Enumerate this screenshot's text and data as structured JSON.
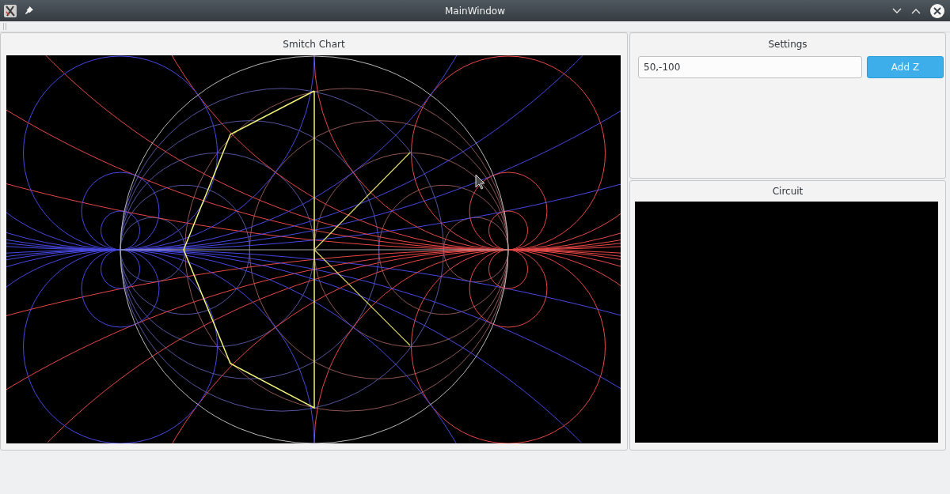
{
  "window": {
    "title": "MainWindow"
  },
  "smith_chart": {
    "title": "Smitch Chart"
  },
  "settings": {
    "title": "Settings",
    "impedance_field": {
      "value": "50,-100"
    },
    "add_button": {
      "label": "Add Z"
    }
  },
  "circuit": {
    "title": "Circuit"
  }
}
